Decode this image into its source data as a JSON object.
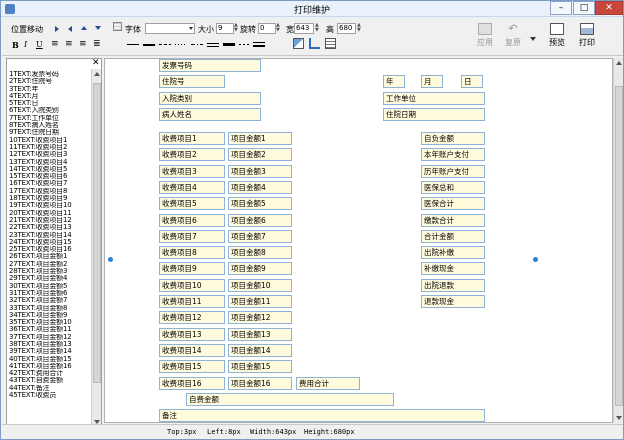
{
  "window": {
    "title": "打印维护"
  },
  "toolbar": {
    "move_label": "位置移动",
    "font_label": "字体",
    "font_value": "",
    "size_label": "大小",
    "size_value": "9",
    "rotate_label": "旋转",
    "rotate_value": "0",
    "width_label": "宽",
    "width_value": "643",
    "height_label": "高",
    "height_value": "680",
    "apply_label": "应用",
    "restore_label": "复原",
    "preview_label": "预览",
    "print_label": "打印"
  },
  "left_list": [
    "1TEXT:发票号码",
    "2TEXT:住院号",
    "3TEXT:年",
    "4TEXT:月",
    "5TEXT:日",
    "6TEXT:入院类别",
    "7TEXT:工作单位",
    "8TEXT:病人姓名",
    "9TEXT:住院日期",
    "10TEXT:收费项目1",
    "11TEXT:收费项目2",
    "12TEXT:收费项目3",
    "13TEXT:收费项目4",
    "14TEXT:收费项目5",
    "15TEXT:收费项目6",
    "16TEXT:收费项目7",
    "17TEXT:收费项目8",
    "18TEXT:收费项目9",
    "19TEXT:收费项目10",
    "20TEXT:收费项目11",
    "21TEXT:收费项目12",
    "22TEXT:收费项目13",
    "23TEXT:收费项目14",
    "24TEXT:收费项目15",
    "25TEXT:收费项目16",
    "26TEXT:项目金额1",
    "27TEXT:项目金额2",
    "28TEXT:项目金额3",
    "29TEXT:项目金额4",
    "30TEXT:项目金额5",
    "31TEXT:项目金额6",
    "32TEXT:项目金额7",
    "33TEXT:项目金额8",
    "34TEXT:项目金额9",
    "35TEXT:项目金额10",
    "36TEXT:项目金额11",
    "37TEXT:项目金额12",
    "38TEXT:项目金额13",
    "39TEXT:项目金额14",
    "40TEXT:项目金额15",
    "41TEXT:项目金额16",
    "42TEXT:费用合计",
    "43TEXT:自费金额",
    "44TEXT:备注",
    "45TEXT:收费员"
  ],
  "fields": {
    "invoice_no": "发票号码",
    "hospital_no": "住院号",
    "year": "年",
    "month": "月",
    "day": "日",
    "admission_type": "入院类别",
    "work_unit": "工作单位",
    "patient_name": "病人姓名",
    "admission_date": "住院日期",
    "charge_items": [
      "收费项目1",
      "收费项目2",
      "收费项目3",
      "收费项目4",
      "收费项目5",
      "收费项目6",
      "收费项目7",
      "收费项目8",
      "收费项目9",
      "收费项目10",
      "收费项目11",
      "收费项目12",
      "收费项目13",
      "收费项目14",
      "收费项目15",
      "收费项目16"
    ],
    "item_amounts": [
      "项目金额1",
      "项目金额2",
      "项目金额3",
      "项目金额4",
      "项目金额5",
      "项目金额6",
      "项目金额7",
      "项目金额8",
      "项目金额9",
      "项目金额10",
      "项目金额11",
      "项目金额12",
      "项目金额13",
      "项目金额14",
      "项目金额15",
      "项目金额16"
    ],
    "fee_total": "费用合计",
    "self_pay": "自费金额",
    "remark": "备注",
    "right_column": [
      "自负金额",
      "本年账户支付",
      "历年账户支付",
      "医保总和",
      "医保合计",
      "缴款合计",
      "合计金额",
      "出院补缴",
      "补缴现金",
      "出院退款",
      "退款现金"
    ]
  },
  "status": {
    "top": "Top:3px",
    "left": "Left:8px",
    "width": "Width:643px",
    "height": "Height:680px"
  }
}
